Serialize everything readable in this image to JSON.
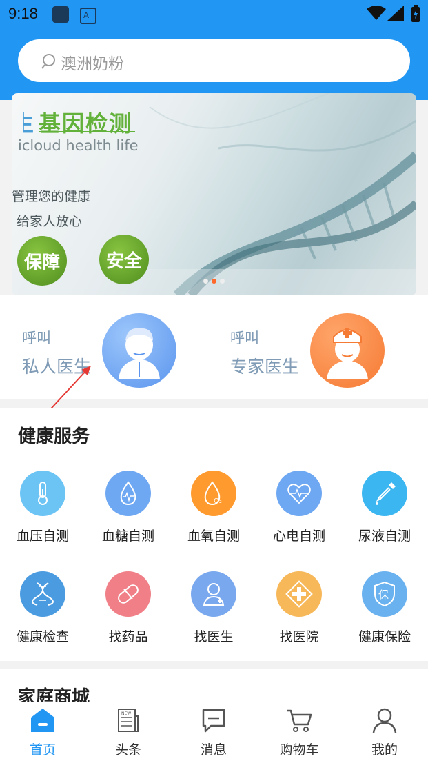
{
  "status_bar": {
    "time": "9:18"
  },
  "search": {
    "placeholder": "澳洲奶粉"
  },
  "banner": {
    "title_prefix": "生",
    "title": "基因检测",
    "subtitle": "icloud health life",
    "line1": "管理您的健康",
    "line2": "给家人放心",
    "badge1": "保障",
    "badge2": "安全",
    "active_dot": 1,
    "dot_count": 3
  },
  "call": {
    "private": {
      "small": "呼叫",
      "big": "私人医生"
    },
    "expert": {
      "small": "呼叫",
      "big": "专家医生"
    }
  },
  "health": {
    "title": "健康服务",
    "items": [
      {
        "label": "血压自测",
        "icon": "thermometer-icon",
        "color": "#6cc4f5"
      },
      {
        "label": "血糖自测",
        "icon": "blood-drop-icon",
        "color": "#6ea7f2"
      },
      {
        "label": "血氧自测",
        "icon": "oxygen-icon",
        "color": "#ff9a2e"
      },
      {
        "label": "心电自测",
        "icon": "heart-pulse-icon",
        "color": "#6ea7f2"
      },
      {
        "label": "尿液自测",
        "icon": "dropper-icon",
        "color": "#3bb6f0"
      },
      {
        "label": "健康检查",
        "icon": "dna-icon",
        "color": "#4a9be0"
      },
      {
        "label": "找药品",
        "icon": "pill-icon",
        "color": "#f07f87"
      },
      {
        "label": "找医生",
        "icon": "doctor-icon",
        "color": "#7aa8ee"
      },
      {
        "label": "找医院",
        "icon": "hospital-cross-icon",
        "color": "#f7b85a"
      },
      {
        "label": "健康保险",
        "icon": "insurance-shield-icon",
        "color": "#6ab2ef"
      }
    ]
  },
  "mall": {
    "title": "家庭商城"
  },
  "nav": {
    "items": [
      {
        "label": "首页",
        "icon": "home-icon",
        "active": true
      },
      {
        "label": "头条",
        "icon": "news-icon",
        "active": false
      },
      {
        "label": "消息",
        "icon": "message-icon",
        "active": false
      },
      {
        "label": "购物车",
        "icon": "cart-icon",
        "active": false
      },
      {
        "label": "我的",
        "icon": "profile-icon",
        "active": false
      }
    ]
  },
  "colors": {
    "primary": "#2196f3",
    "call_text": "#7f9bb5"
  }
}
